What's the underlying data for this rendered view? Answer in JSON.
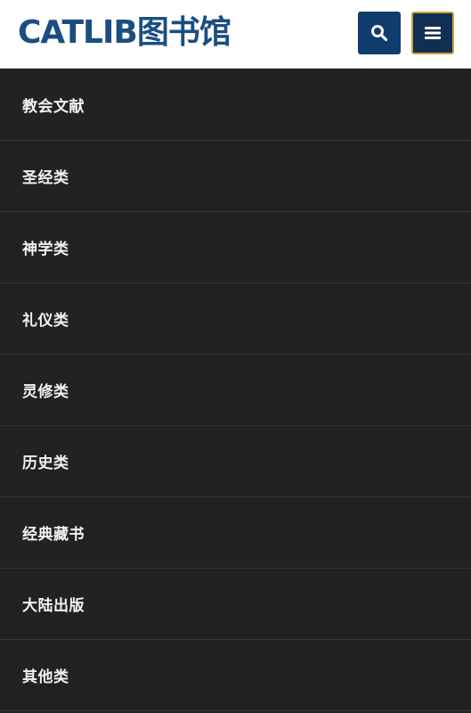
{
  "header": {
    "logo_text": "CATLIB图书馆",
    "search_icon": "search-icon",
    "menu_icon": "hamburger-menu-icon"
  },
  "colors": {
    "brand": "#1b4e80",
    "button_bg": "#0e3d6e",
    "menu_border": "#c9a23c",
    "nav_bg": "#222222"
  },
  "nav": {
    "items": [
      {
        "label": "教会文献"
      },
      {
        "label": "圣经类"
      },
      {
        "label": "神学类"
      },
      {
        "label": "礼仪类"
      },
      {
        "label": "灵修类"
      },
      {
        "label": "历史类"
      },
      {
        "label": "经典藏书"
      },
      {
        "label": "大陆出版"
      },
      {
        "label": "其他类"
      }
    ]
  }
}
